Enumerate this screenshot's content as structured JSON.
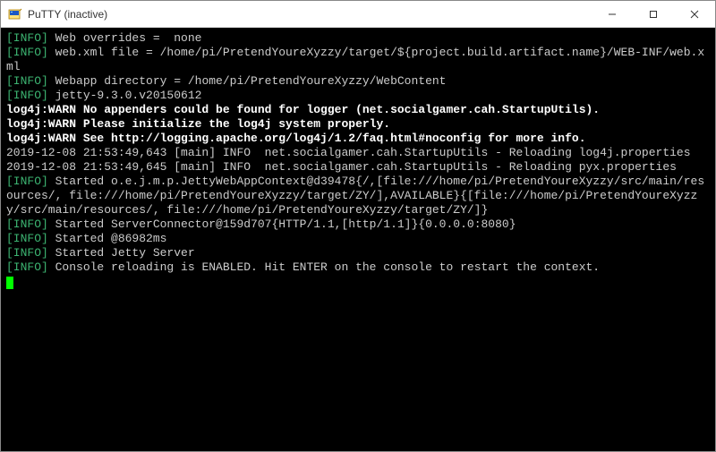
{
  "window": {
    "title": "PuTTY (inactive)"
  },
  "terminal": {
    "lines": [
      {
        "segs": [
          {
            "style": "info-tag",
            "text": "[INFO]"
          },
          {
            "style": "",
            "text": " Web overrides =  none"
          }
        ]
      },
      {
        "segs": [
          {
            "style": "info-tag",
            "text": "[INFO]"
          },
          {
            "style": "",
            "text": " web.xml file = /home/pi/PretendYoureXyzzy/target/${project.build.artifact.name}/WEB-INF/web.xml"
          }
        ]
      },
      {
        "segs": [
          {
            "style": "info-tag",
            "text": "[INFO]"
          },
          {
            "style": "",
            "text": " Webapp directory = /home/pi/PretendYoureXyzzy/WebContent"
          }
        ]
      },
      {
        "segs": [
          {
            "style": "info-tag",
            "text": "[INFO]"
          },
          {
            "style": "",
            "text": " jetty-9.3.0.v20150612"
          }
        ]
      },
      {
        "segs": [
          {
            "style": "bold-white",
            "text": "log4j:WARN No appenders could be found for logger (net.socialgamer.cah.StartupUtils)."
          }
        ]
      },
      {
        "segs": [
          {
            "style": "bold-white",
            "text": "log4j:WARN Please initialize the log4j system properly."
          }
        ]
      },
      {
        "segs": [
          {
            "style": "bold-white",
            "text": "log4j:WARN See http://logging.apache.org/log4j/1.2/faq.html#noconfig for more info."
          }
        ]
      },
      {
        "segs": [
          {
            "style": "",
            "text": "2019-12-08 21:53:49,643 [main] INFO  net.socialgamer.cah.StartupUtils - Reloading log4j.properties"
          }
        ]
      },
      {
        "segs": [
          {
            "style": "",
            "text": "2019-12-08 21:53:49,645 [main] INFO  net.socialgamer.cah.StartupUtils - Reloading pyx.properties"
          }
        ]
      },
      {
        "segs": [
          {
            "style": "info-tag",
            "text": "[INFO]"
          },
          {
            "style": "",
            "text": " Started o.e.j.m.p.JettyWebAppContext@d39478{/,[file:///home/pi/PretendYoureXyzzy/src/main/resources/, file:///home/pi/PretendYoureXyzzy/target/ZY/],AVAILABLE}{[file:///home/pi/PretendYoureXyzzy/src/main/resources/, file:///home/pi/PretendYoureXyzzy/target/ZY/]}"
          }
        ]
      },
      {
        "segs": [
          {
            "style": "info-tag",
            "text": "[INFO]"
          },
          {
            "style": "",
            "text": " Started ServerConnector@159d707{HTTP/1.1,[http/1.1]}{0.0.0.0:8080}"
          }
        ]
      },
      {
        "segs": [
          {
            "style": "info-tag",
            "text": "[INFO]"
          },
          {
            "style": "",
            "text": " Started @86982ms"
          }
        ]
      },
      {
        "segs": [
          {
            "style": "info-tag",
            "text": "[INFO]"
          },
          {
            "style": "",
            "text": " Started Jetty Server"
          }
        ]
      },
      {
        "segs": [
          {
            "style": "info-tag",
            "text": "[INFO]"
          },
          {
            "style": "",
            "text": " Console reloading is ENABLED. Hit ENTER on the console to restart the context."
          }
        ]
      }
    ]
  }
}
